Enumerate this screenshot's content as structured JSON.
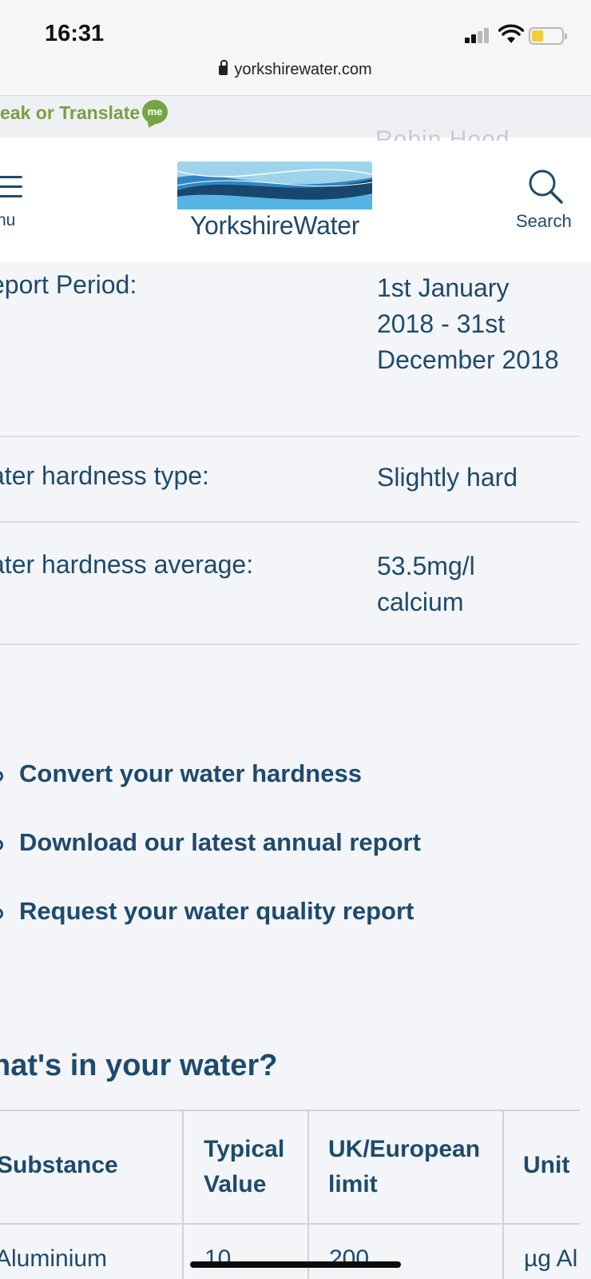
{
  "status_bar": {
    "time": "16:31"
  },
  "browser": {
    "url": "yorkshirewater.com"
  },
  "translate": {
    "label": "eak or Translate",
    "badge": "me"
  },
  "header": {
    "menu_label": "nu",
    "logo_text": "YorkshireWater",
    "search_label": "Search"
  },
  "info": {
    "rows": [
      {
        "label": "eport Period:",
        "value": "1st January 2018 - 31st December 2018"
      },
      {
        "label": "ater hardness type:",
        "value": "Slightly hard"
      },
      {
        "label": "ater hardness average:",
        "value": "53.5mg/l calcium"
      }
    ]
  },
  "links": [
    {
      "label": "Convert your water hardness"
    },
    {
      "label": "Download our latest annual report"
    },
    {
      "label": "Request your water quality report"
    }
  ],
  "section": {
    "heading": "hat's in your water?"
  },
  "table": {
    "headers": [
      "Substance",
      "Typical Value",
      "UK/European limit",
      "Unit"
    ],
    "rows": [
      {
        "substance": "Aluminium",
        "typical": "10",
        "limit": "200",
        "unit": "µg Al"
      }
    ]
  },
  "colors": {
    "brand_navy": "#1e4a6e",
    "translate_green": "#7d9e43",
    "page_bg": "#f3f5f8"
  }
}
